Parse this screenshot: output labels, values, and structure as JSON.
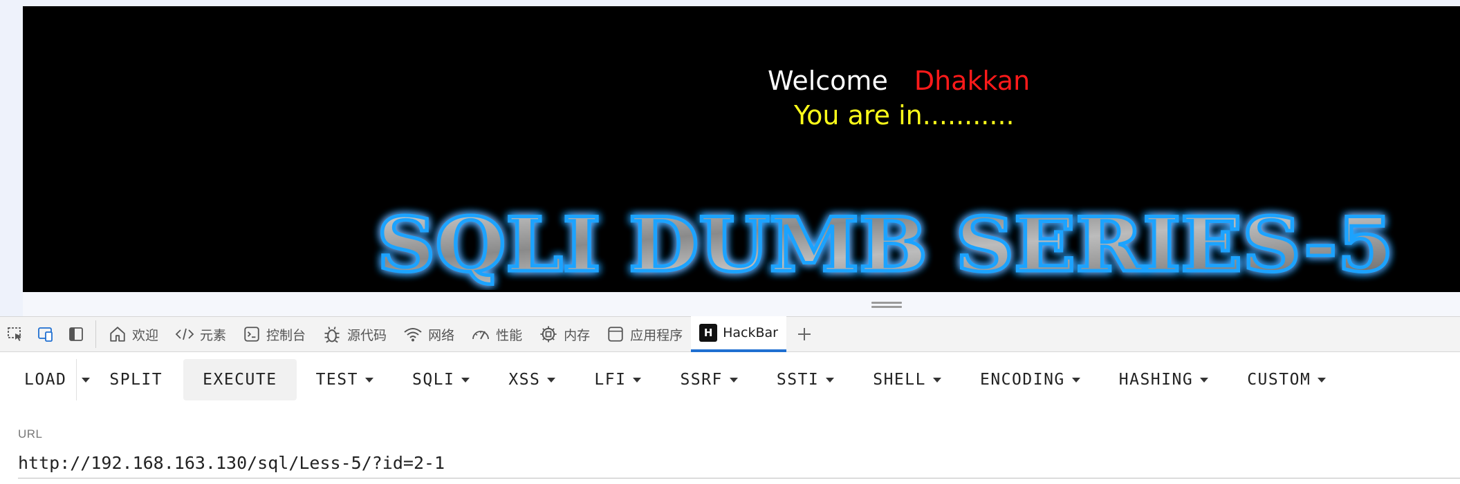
{
  "page": {
    "welcome": "Welcome",
    "username": "Dhakkan",
    "status": "You are in...........",
    "banner": "SQLI DUMB SERIES-5"
  },
  "devtools": {
    "tabs": [
      {
        "label": "欢迎",
        "icon": "home-icon"
      },
      {
        "label": "元素",
        "icon": "code-icon"
      },
      {
        "label": "控制台",
        "icon": "console-icon"
      },
      {
        "label": "源代码",
        "icon": "bug-icon"
      },
      {
        "label": "网络",
        "icon": "wifi-icon"
      },
      {
        "label": "性能",
        "icon": "gauge-icon"
      },
      {
        "label": "内存",
        "icon": "chip-icon"
      },
      {
        "label": "应用程序",
        "icon": "app-window-icon"
      },
      {
        "label": "HackBar",
        "icon": "hackbar-logo",
        "active": true
      }
    ],
    "hackbar_logo_letter": "H"
  },
  "hackbar": {
    "buttons": [
      "LOAD",
      "SPLIT",
      "EXECUTE",
      "TEST",
      "SQLI",
      "XSS",
      "LFI",
      "SSRF",
      "SSTI",
      "SHELL",
      "ENCODING",
      "HASHING",
      "CUSTOM"
    ],
    "url_label": "URL",
    "url_value": "http://192.168.163.130/sql/Less-5/?id=2-1"
  },
  "colors": {
    "welcome": "#ffffff",
    "username": "#ff1a1a",
    "status": "#ffff1a",
    "banner_glow": "#1aa3ff",
    "active_tab_underline": "#1f6fd1"
  }
}
